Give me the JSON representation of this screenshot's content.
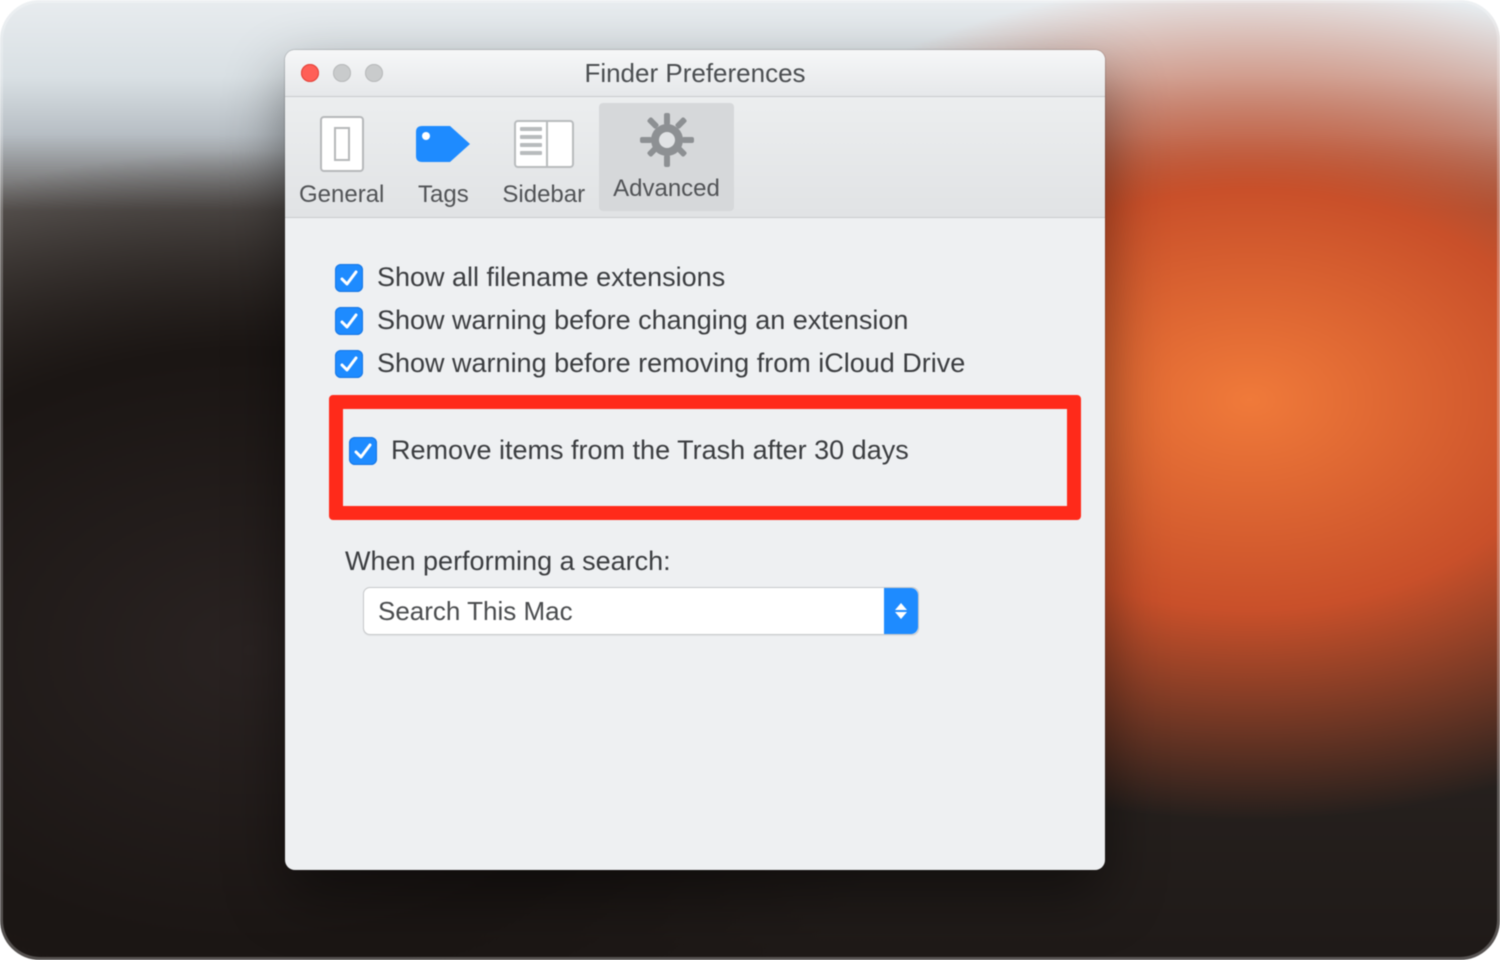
{
  "window": {
    "title": "Finder Preferences"
  },
  "toolbar": {
    "items": [
      {
        "label": "General",
        "selected": false
      },
      {
        "label": "Tags",
        "selected": false
      },
      {
        "label": "Sidebar",
        "selected": false
      },
      {
        "label": "Advanced",
        "selected": true
      }
    ]
  },
  "advanced": {
    "options": [
      {
        "label": "Show all filename extensions",
        "checked": true
      },
      {
        "label": "Show warning before changing an extension",
        "checked": true
      },
      {
        "label": "Show warning before removing from iCloud Drive",
        "checked": true
      }
    ],
    "highlighted_option": {
      "label": "Remove items from the Trash after 30 days",
      "checked": true
    },
    "search_section": {
      "label": "When performing a search:",
      "selected": "Search This Mac"
    }
  },
  "colors": {
    "accent": "#1e8bff",
    "highlight_border": "#ff2a1a"
  }
}
